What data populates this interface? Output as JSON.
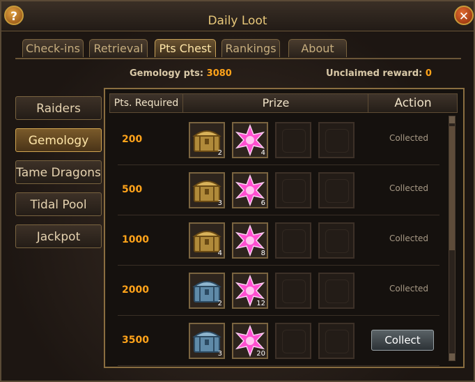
{
  "window": {
    "title": "Daily Loot"
  },
  "help_label": "?",
  "close_label": "✕",
  "tabs": [
    {
      "label": "Check-ins",
      "active": false
    },
    {
      "label": "Retrieval",
      "active": false
    },
    {
      "label": "Pts Chest",
      "active": true
    },
    {
      "label": "Rankings",
      "active": false
    },
    {
      "label": "About",
      "active": false
    }
  ],
  "info": {
    "gemology_label": "Gemology pts:",
    "gemology_value": "3080",
    "unclaimed_label": "Unclaimed reward:",
    "unclaimed_value": "0"
  },
  "sidebar": {
    "items": [
      {
        "label": "Raiders",
        "active": false
      },
      {
        "label": "Gemology",
        "active": true
      },
      {
        "label": "Tame Dragons",
        "active": false
      },
      {
        "label": "Tidal Pool",
        "active": false
      },
      {
        "label": "Jackpot",
        "active": false
      }
    ]
  },
  "table": {
    "headers": {
      "pts": "Pts. Required",
      "prize": "Prize",
      "action": "Action"
    },
    "rows": [
      {
        "pts": "200",
        "chest_type": "gold-chest-icon",
        "chest_qty": "2",
        "gem_qty": "4",
        "action": "Collected"
      },
      {
        "pts": "500",
        "chest_type": "gold-chest-icon",
        "chest_qty": "3",
        "gem_qty": "6",
        "action": "Collected"
      },
      {
        "pts": "1000",
        "chest_type": "gold-chest-icon",
        "chest_qty": "4",
        "gem_qty": "8",
        "action": "Collected"
      },
      {
        "pts": "2000",
        "chest_type": "silver-chest-icon",
        "chest_qty": "2",
        "gem_qty": "12",
        "action": "Collected"
      },
      {
        "pts": "3500",
        "chest_type": "silver-chest-icon",
        "chest_qty": "3",
        "gem_qty": "20",
        "action": "Collect"
      }
    ]
  },
  "colors": {
    "accent": "#ffa31a",
    "gold_text": "#e8c87a",
    "gem": "#ff4fd0"
  }
}
